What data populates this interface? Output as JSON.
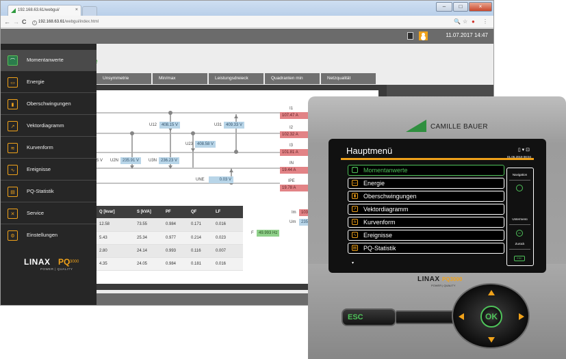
{
  "browser": {
    "tab_title": "192.168.63.61/webgui/",
    "tab_close": "×",
    "url_host": "192.168.63.61",
    "url_path": "/webgui/index.html",
    "nav_back": "←",
    "nav_forward": "→",
    "nav_reload": "C",
    "info_badge": "i",
    "icons": {
      "zoom": "🔍",
      "star": "☆",
      "addon": "●",
      "menu": "⋮"
    },
    "window_controls": {
      "min": "–",
      "max": "□",
      "close": "×"
    }
  },
  "header": {
    "datetime": "11.07.2017  14:47"
  },
  "content": {
    "title_fragment": "rte",
    "tabs": [
      "Unsymmetrie",
      "Min/max",
      "Leistungsdreieck",
      "Quadranten min",
      "Netzqualität"
    ]
  },
  "phasor": {
    "left_v_partial": "5 V",
    "u12": {
      "label": "U12",
      "value": "408.15 V"
    },
    "u31": {
      "label": "U31",
      "value": "409.33 V"
    },
    "u23": {
      "label": "U23",
      "value": "408.58 V"
    },
    "u2n": {
      "label": "U2N",
      "value": "235.91 V"
    },
    "u3n": {
      "label": "U3N",
      "value": "236.23 V"
    },
    "une": {
      "label": "UNE",
      "value": "0.03 V"
    },
    "i1": {
      "label": "I1",
      "value": "107.47 A"
    },
    "i2": {
      "label": "I2",
      "value": "102.32 A"
    },
    "i3": {
      "label": "I3",
      "value": "101.81 A"
    },
    "in": {
      "label": "IN",
      "value": "19.44 A"
    },
    "ipe": {
      "label": "IPE",
      "value": "19.78 A"
    },
    "freq": {
      "label": "F",
      "value": "49.993 Hz"
    },
    "im": {
      "label": "Im",
      "value": "103"
    },
    "um": {
      "label": "Um",
      "value": "235"
    }
  },
  "table": {
    "headers": [
      "Q [kvar]",
      "S [kVA]",
      "PF",
      "QF",
      "LF"
    ],
    "rows": [
      [
        "12.58",
        "73.55",
        "0.984",
        "0.171",
        "0.016"
      ],
      [
        "5.43",
        "25.34",
        "0.977",
        "0.214",
        "0.023"
      ],
      [
        "2.80",
        "24.14",
        "0.993",
        "0.116",
        "0.007"
      ],
      [
        "4.35",
        "24.05",
        "0.984",
        "0.181",
        "0.016"
      ]
    ]
  },
  "sidebar": {
    "items": [
      {
        "label": "Momentanwerte",
        "icon": "gauge-icon",
        "glyph": "⌒"
      },
      {
        "label": "Energie",
        "icon": "energy-meter-icon",
        "glyph": "▭"
      },
      {
        "label": "Oberschwingungen",
        "icon": "harmonics-bars-icon",
        "glyph": "▮"
      },
      {
        "label": "Vektordiagramm",
        "icon": "vector-diagram-icon",
        "glyph": "↗"
      },
      {
        "label": "Kurvenform",
        "icon": "waveform-icon",
        "glyph": "≋"
      },
      {
        "label": "Ereignisse",
        "icon": "events-icon",
        "glyph": "∿"
      },
      {
        "label": "PQ-Statistik",
        "icon": "pq-statistics-icon",
        "glyph": "▤"
      },
      {
        "label": "Service",
        "icon": "service-tools-icon",
        "glyph": "✕"
      },
      {
        "label": "Einstellungen",
        "icon": "settings-gear-icon",
        "glyph": "⚙"
      }
    ],
    "logo": {
      "linax": "LINAX",
      "pq": "PQ",
      "model": "3000",
      "sub": "POWER  |  QUALITY"
    }
  },
  "device": {
    "brand": "CAMILLE BAUER",
    "screen_title": "Hauptmenü",
    "screen_date": "01.05.2019  08:04",
    "status_icons": "▯ ▾ ⊡",
    "menu": [
      {
        "label": "Momentanwerte",
        "glyph": "⌒"
      },
      {
        "label": "Energie",
        "glyph": "▭"
      },
      {
        "label": "Oberschwingungen",
        "glyph": "▮"
      },
      {
        "label": "Vektordiagramm",
        "glyph": "↗"
      },
      {
        "label": "Kurvenform",
        "glyph": "≋"
      },
      {
        "label": "Ereignisse",
        "glyph": "∿"
      },
      {
        "label": "PQ-Statistik",
        "glyph": "▤"
      }
    ],
    "more_indicator": "▾",
    "side_panel": {
      "navigation": "Navigation",
      "submenu": "Untermenü",
      "ok": "OK",
      "back": "Zurück",
      "esc_small": "ESC"
    },
    "front_brand": {
      "linax": "LINAX",
      "pq": "PQ3000",
      "sub": "POWER  |  QUALITY"
    },
    "esc_label": "ESC",
    "ok_label": "OK"
  },
  "colors": {
    "accent_orange": "#f0a21a",
    "accent_green": "#4fc35a",
    "voltage_box": "#b8d5e8",
    "current_box": "#e28386",
    "frequency_box": "#8fd08a",
    "sidebar_bg": "#262626"
  }
}
